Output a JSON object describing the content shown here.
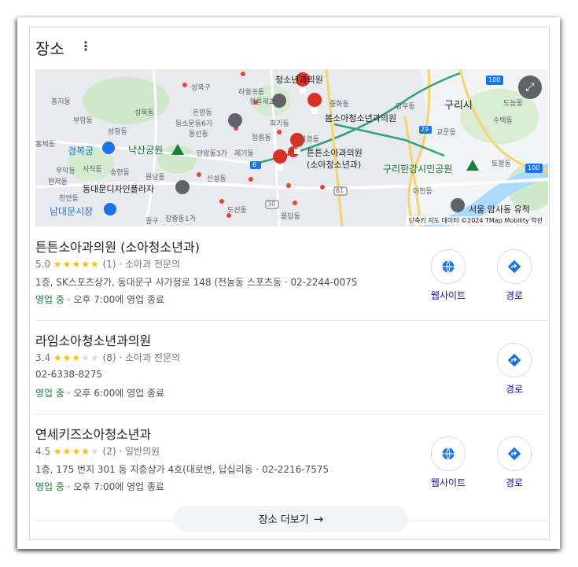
{
  "header": {
    "title": "장소",
    "more_icon": "⋮"
  },
  "map": {
    "attribution": "단축키   지도 데이터 ©2024 TMap Mobility   약관",
    "labels": {
      "guri": "구리시",
      "gyeongbokgung": "경복궁",
      "naksan": "낙산공원",
      "ddp": "동대문디자인플라자",
      "namdaemun": "남대문시장",
      "hangang": "구리한강시민공원",
      "amsa": "서울 암사동 유적",
      "clinic1": "튼튼소아과의원",
      "clinic1b": "(소아청소년과)",
      "clinic2": "봄소아청소년과의원",
      "clinic3": "청소년과의원",
      "seongbuk": "성북구",
      "hongji": "홍지동",
      "buam": "부암동",
      "samcheong": "삼청동",
      "hongje": "홍제동",
      "muak": "무악동",
      "sajik": "사직동",
      "hyeonjeo": "현저동",
      "cheonyeon": "천연동",
      "songhyeon": "송현동",
      "wonnam": "원남동",
      "donam": "돈암동",
      "dongsomun": "동소문동6가",
      "dongseon": "동선동",
      "anam": "안암동3가",
      "jegi": "제기동",
      "sinseol": "신설동",
      "jangchung": "장충동1가",
      "jung": "중구",
      "doseon": "도선동",
      "yongdap": "용답동",
      "hoegi": "회기동",
      "hwigyeong": "휘경동",
      "jeongreung": "정릉동",
      "hawolgok": "하월곡동",
      "jeongreung2": "정릉제2동",
      "junghwa": "중화동",
      "mangu": "망우동",
      "gyomun": "교문동",
      "achon": "아천동",
      "sutaek": "수택동",
      "tokpyeong": "토평동",
      "donong": "도농동",
      "seongbuk2": "성북동",
      "r6": "6",
      "r29": "29",
      "r30": "30",
      "r61": "61",
      "r100a": "100",
      "r100b": "100"
    }
  },
  "places": [
    {
      "name": "튼튼소아과의원 (소아청소년과)",
      "rating": "5.0",
      "stars_full": "★★★★★",
      "stars_empty": "",
      "reviews": "(1)",
      "category": "· 소아과 전문의",
      "address": "1층, SK스포츠상가, 동대문구 사가정로 148 (전농동 스포츠동 · 02-2244-0075",
      "open": "영업 중",
      "hours": " · 오후 7:00에 영업 종료",
      "website_label": "웹사이트",
      "directions_label": "경로"
    },
    {
      "name": "라임소아청소년과의원",
      "rating": "3.4",
      "stars_full": "★★★",
      "stars_empty": "★★",
      "reviews": "(8)",
      "category": "· 소아과 전문의",
      "address": "02-6338-8275",
      "open": "영업 중",
      "hours": " · 오후 6:00에 영업 종료",
      "directions_label": "경로"
    },
    {
      "name": "연세키즈소아청소년과",
      "rating": "4.5",
      "stars_full": "★★★★",
      "stars_empty": "★",
      "reviews": "(2)",
      "category": "· 일반의원",
      "address": "1층, 175 번지 301 동 지층상가 4호(대로변, 답십리동 · 02-2216-7575",
      "open": "영업 중",
      "hours": " · 오후 7:00에 영업 종료",
      "website_label": "웹사이트",
      "directions_label": "경로"
    }
  ],
  "more_places": {
    "label": "장소 더보기",
    "arrow": "→"
  },
  "colors": {
    "link": "#1a0dab",
    "open": "#188038",
    "star": "#fbbc04",
    "pin": "#ea4335",
    "icon_blue": "#1a73e8"
  }
}
